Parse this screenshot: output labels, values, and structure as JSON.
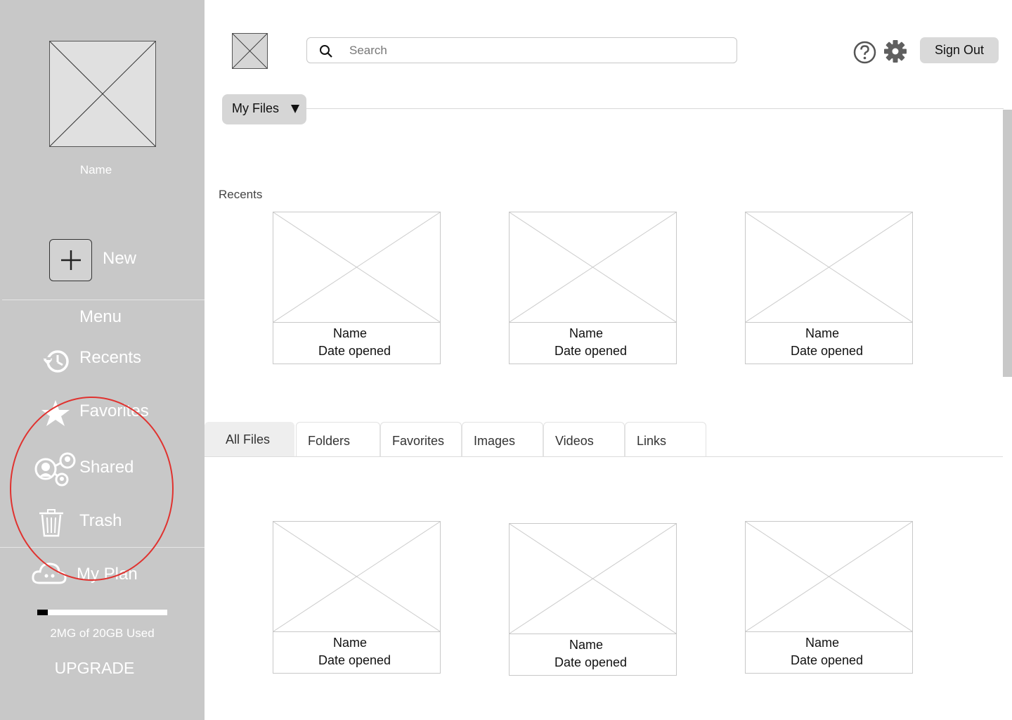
{
  "sidebar": {
    "user_name": "Name",
    "new_label": "New",
    "menu_heading": "Menu",
    "items": [
      {
        "label": "Recents",
        "icon": "history-icon"
      },
      {
        "label": "Favorites",
        "icon": "star-icon"
      },
      {
        "label": "Shared",
        "icon": "shared-users-icon"
      },
      {
        "label": "Trash",
        "icon": "trash-icon"
      }
    ],
    "plan_label": "My Plan",
    "storage_text": "2MG of 20GB Used",
    "storage_fraction": 0.08,
    "upgrade_label": "UPGRADE"
  },
  "header": {
    "search_placeholder": "Search",
    "signout_label": "Sign Out"
  },
  "files_dropdown": {
    "label": "My Files"
  },
  "recents": {
    "title": "Recents",
    "cards": [
      {
        "name": "Name",
        "date": "Date opened"
      },
      {
        "name": "Name",
        "date": "Date opened"
      },
      {
        "name": "Name",
        "date": "Date opened"
      }
    ]
  },
  "tabs": [
    {
      "label": "All Files",
      "active": true
    },
    {
      "label": "Folders"
    },
    {
      "label": "Favorites"
    },
    {
      "label": "Images"
    },
    {
      "label": "Videos"
    },
    {
      "label": "Links"
    }
  ],
  "files": {
    "cards": [
      {
        "name": "Name",
        "date": "Date opened"
      },
      {
        "name": "Name",
        "date": "Date opened"
      },
      {
        "name": "Name",
        "date": "Date opened"
      }
    ]
  },
  "colors": {
    "sidebar_bg": "#c8c8c8",
    "highlight_circle": "#e0322f"
  }
}
